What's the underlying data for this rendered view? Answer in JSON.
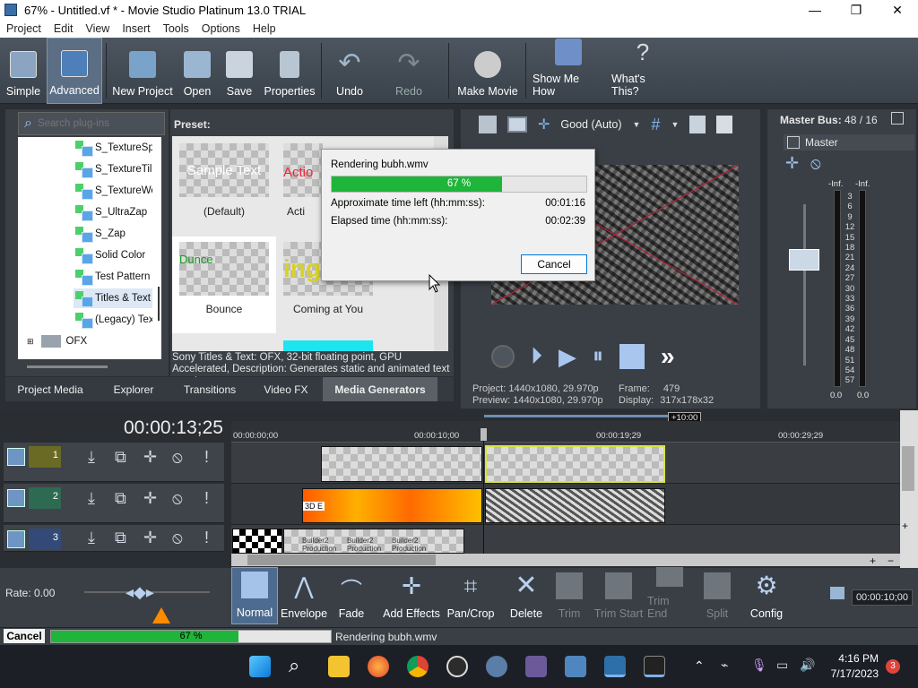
{
  "window": {
    "title": "67% - Untitled.vf * - Movie Studio Platinum 13.0 TRIAL",
    "minimize": "—",
    "maximize": "❐",
    "close": "✕"
  },
  "menu": [
    "Project",
    "Edit",
    "View",
    "Insert",
    "Tools",
    "Options",
    "Help"
  ],
  "toolbar": {
    "simple": "Simple",
    "advanced": "Advanced",
    "new_project": "New Project",
    "open": "Open",
    "save": "Save",
    "properties": "Properties",
    "undo": "Undo",
    "redo": "Redo",
    "make_movie": "Make Movie",
    "show_me_how": "Show Me How",
    "whats_this": "What's This?"
  },
  "search": {
    "placeholder": "Search plug-ins"
  },
  "tree": [
    "S_TextureSp",
    "S_TextureTil",
    "S_TextureWe",
    "S_UltraZap",
    "S_Zap",
    "Solid Color",
    "Test Pattern",
    "Titles & Text",
    "(Legacy) Tex",
    "OFX"
  ],
  "preset": {
    "header": "Preset:",
    "items": [
      "(Default)",
      "Acti",
      "Bounce",
      "Coming at You"
    ],
    "thumb_texts": [
      "Sample Text",
      "Actio",
      "Dunce",
      "ing"
    ],
    "description": "Sony Titles & Text: OFX, 32-bit floating point, GPU Accelerated, Description: Generates static and animated text events."
  },
  "tabs": [
    "Project Media",
    "Explorer",
    "Transitions",
    "Video FX",
    "Media Generators"
  ],
  "render_dialog": {
    "title": "Rendering bubh.wmv",
    "progress_text": "67 %",
    "progress": 0.67,
    "time_left_label": "Approximate time left (hh:mm:ss):",
    "time_left": "00:01:16",
    "elapsed_label": "Elapsed time (hh:mm:ss):",
    "elapsed": "00:02:39",
    "cancel": "Cancel"
  },
  "preview": {
    "quality": "Good (Auto)",
    "project_label": "Project:",
    "project_value": "1440x1080, 29.970p",
    "preview_label": "Preview:",
    "preview_value": "1440x1080, 29.970p",
    "frame_label": "Frame:",
    "frame_value": "479",
    "display_label": "Display:",
    "display_value": "317x178x32"
  },
  "master": {
    "title": "Master Bus:",
    "value": "48 / 16",
    "label": "Master",
    "inf_left": "-Inf.",
    "inf_right": "-Inf.",
    "scale": [
      "3",
      "6",
      "9",
      "12",
      "15",
      "18",
      "21",
      "24",
      "27",
      "30",
      "33",
      "36",
      "39",
      "42",
      "45",
      "48",
      "51",
      "54",
      "57"
    ],
    "bottom_left": "0.0",
    "bottom_right": "0.0"
  },
  "timeline": {
    "timecode": "00:00:13;25",
    "ruler": [
      "00:00:00;00",
      "00:00:10;00",
      "00:00:19;29",
      "00:00:29;29"
    ],
    "marker": "+10:00",
    "tracks": [
      "1",
      "2",
      "3"
    ],
    "clip_labels": [
      "Builder2 Production",
      "Builder2 Production",
      "Builder2 Production",
      "3D E"
    ]
  },
  "rate": "Rate: 0.00",
  "edit_tools": {
    "normal": "Normal",
    "envelope": "Envelope",
    "fade": "Fade",
    "add_effects": "Add Effects",
    "pan_crop": "Pan/Crop",
    "delete": "Delete",
    "trim": "Trim",
    "trim_start": "Trim Start",
    "trim_end": "Trim End",
    "split": "Split",
    "config": "Config",
    "time": "00:00:10;00"
  },
  "status": {
    "cancel": "Cancel",
    "progress_text": "67 %",
    "progress": 0.67,
    "message": "Rendering bubh.wmv"
  },
  "taskbar": {
    "time": "4:16 PM",
    "date": "7/17/2023",
    "badge": "3"
  },
  "colors": {
    "progress": "#1fb53a",
    "selection": "#d7e342",
    "accent": "#3a8fd8"
  }
}
